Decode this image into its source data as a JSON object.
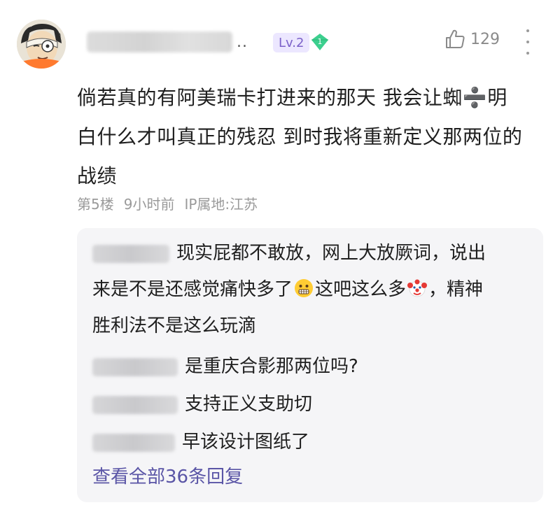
{
  "comment": {
    "level_badge": "Lv.2",
    "gem_number": "1",
    "like_count": "129",
    "content_lines": [
      "倘若真的有阿美瑞卡打进来的那天 我会让蜘➗明",
      "白什么才叫真正的残忍 到时我将重新定义那两位的",
      "战绩"
    ],
    "floor": "第5楼",
    "time": "9小时前",
    "ip": "IP属地:江苏"
  },
  "replies": {
    "items": [
      {
        "text_a": "现实屁都不敢放，网上大放厥词，说出",
        "text_b": "来是不是还感觉痛快多了",
        "text_c": "这吧这么多",
        "text_d": "，精神",
        "text_e": "胜利法不是这么玩滴"
      },
      {
        "text": "是重庆合影那两位吗?"
      },
      {
        "text": "支持正义支助切"
      },
      {
        "text": "早该设计图纸了"
      }
    ],
    "view_all": "查看全部36条回复"
  },
  "icons": {
    "like": "thumbs-up-icon",
    "more": "more-vertical-icon",
    "gem": "diamond-icon",
    "emoji_1": "grimacing-emoji",
    "emoji_2": "clown-emoji"
  },
  "colors": {
    "level_badge_bg": "#ece7ff",
    "level_badge_text": "#7b61c9",
    "gem": "#3ccf8e",
    "link": "#5a55a6",
    "reply_bg": "#f5f5f7"
  }
}
